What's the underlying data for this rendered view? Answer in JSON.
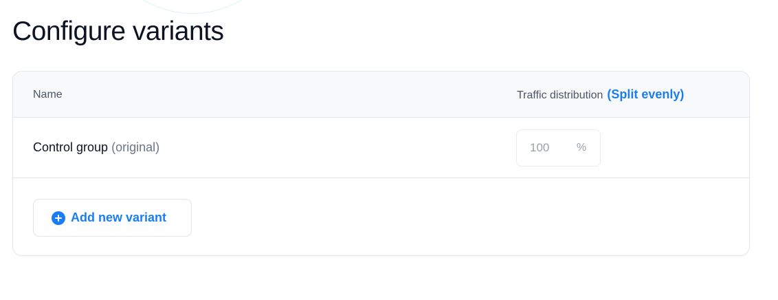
{
  "page": {
    "title": "Configure variants"
  },
  "table": {
    "headers": {
      "name": "Name",
      "traffic": "Traffic distribution",
      "split_link": "(Split evenly)"
    },
    "rows": [
      {
        "name": "Control group",
        "tag": "(original)",
        "traffic_value": "100",
        "traffic_unit": "%"
      }
    ]
  },
  "actions": {
    "add_variant_label": "Add new variant"
  },
  "colors": {
    "accent": "#1a7ef2",
    "text_primary": "#0d1322",
    "text_secondary": "#4b5565",
    "border": "#e3e7ee",
    "header_bg": "#f8f9fb"
  },
  "icons": {
    "add_variant": "plus-circle-icon"
  }
}
